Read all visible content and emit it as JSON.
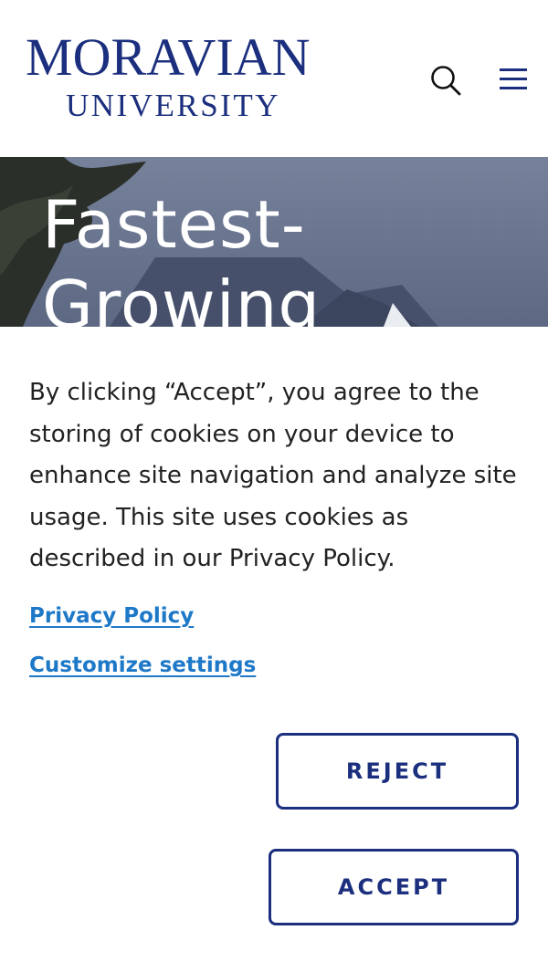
{
  "header": {
    "logo_line1": "MORAVIAN",
    "logo_line2": "UNIVERSITY",
    "search_icon": "search-icon",
    "menu_icon": "hamburger-menu-icon"
  },
  "hero": {
    "title": "Fastest-Growing"
  },
  "cookie_dialog": {
    "message": "By clicking “Accept”, you agree to the storing of cookies on your device to enhance site navigation and analyze site usage. This site uses cookies as described in our Privacy Policy.",
    "privacy_link": "Privacy Policy",
    "customize_link": "Customize settings",
    "reject_label": "REJECT",
    "accept_label": "ACCEPT"
  },
  "colors": {
    "brand_navy": "#1b2f7e",
    "link_blue": "#1e78c8",
    "text": "#222222"
  }
}
